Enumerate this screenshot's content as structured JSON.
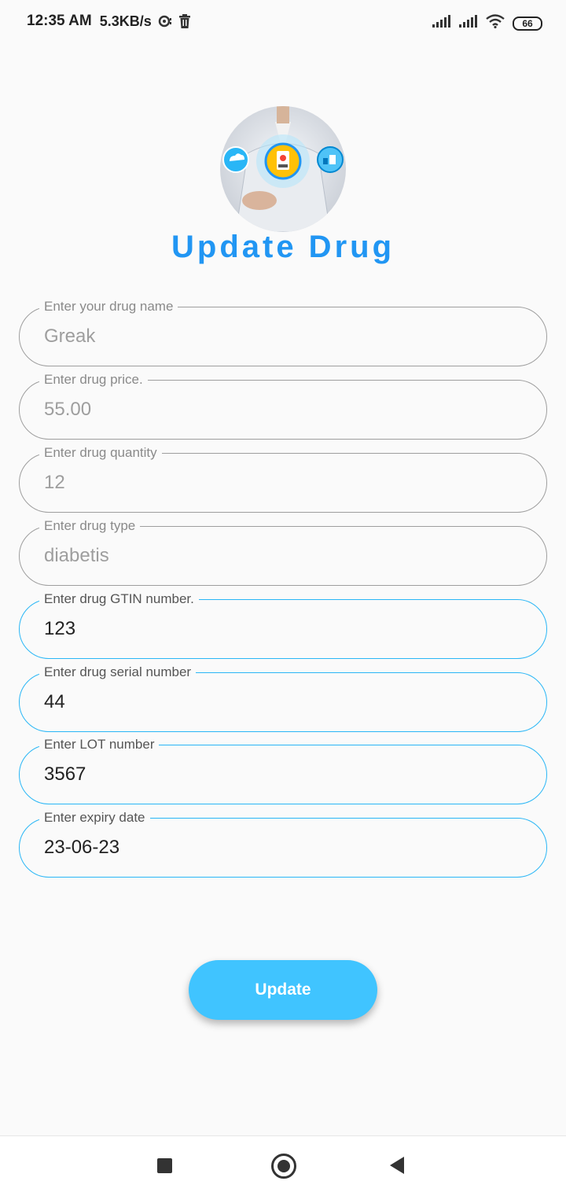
{
  "status_bar": {
    "time": "12:35 AM",
    "speed": "5.3KB/s",
    "battery": "66"
  },
  "header": {
    "title": "Update Drug"
  },
  "form": {
    "fields": [
      {
        "label": "Enter your drug name",
        "value": "Greak"
      },
      {
        "label": "Enter drug price.",
        "value": "55.00"
      },
      {
        "label": "Enter drug quantity",
        "value": "12"
      },
      {
        "label": "Enter drug type",
        "value": "diabetis"
      },
      {
        "label": "Enter drug GTIN number.",
        "value": "123"
      },
      {
        "label": "Enter drug serial number",
        "value": "44"
      },
      {
        "label": "Enter LOT number",
        "value": "3567"
      },
      {
        "label": "Enter expiry date",
        "value": "23-06-23"
      }
    ],
    "update_label": "Update"
  },
  "colors": {
    "title": "#2196f3",
    "button": "#40c4ff",
    "active_border": "#29b6f6",
    "inactive_border": "#9e9e9e"
  }
}
